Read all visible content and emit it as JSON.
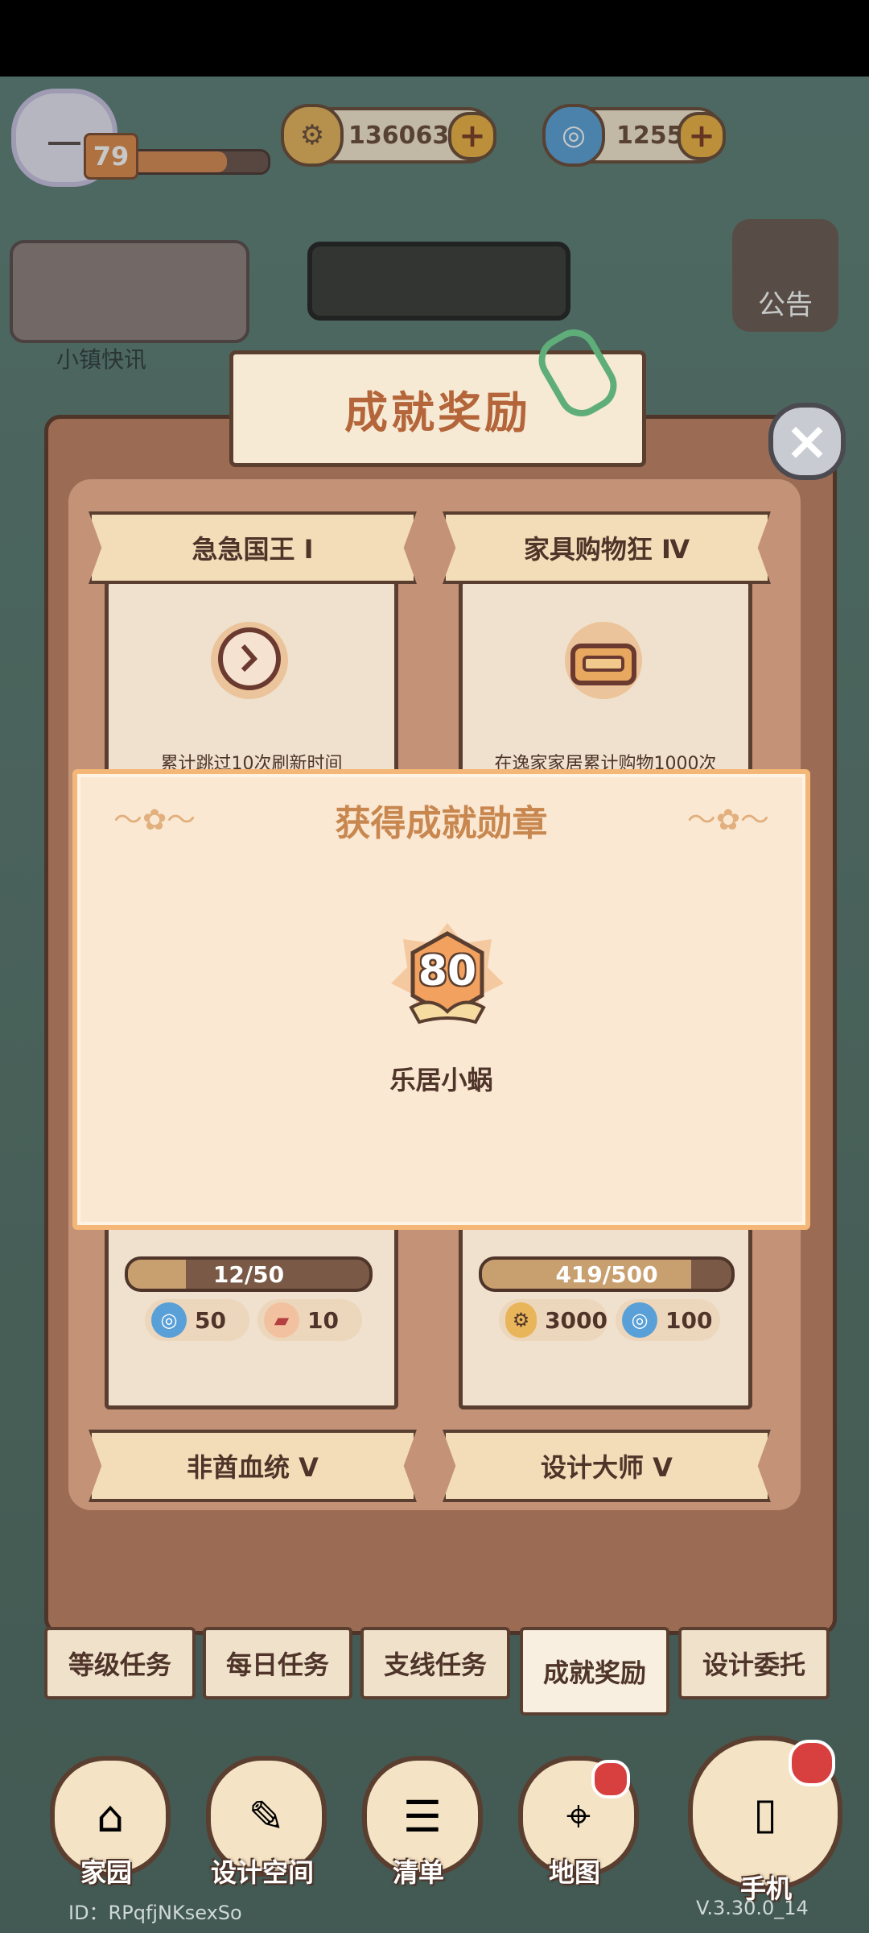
{
  "player": {
    "level": "79",
    "level_progress": 0.7
  },
  "currencies": [
    {
      "name": "coin",
      "icon": "coin-icon",
      "value": "136063"
    },
    {
      "name": "swirl",
      "icon": "swirl-icon",
      "value": "1255"
    }
  ],
  "hud": {
    "news_label": "小镇快讯",
    "notice_label": "公告"
  },
  "panel": {
    "title": "成就奖励"
  },
  "cards": [
    {
      "title": "急急国王 Ⅰ",
      "desc": "累计跳过10次刷新时间"
    },
    {
      "title": "家具购物狂 Ⅳ",
      "desc": "在逸家家居累计购物1000次"
    },
    {
      "title": "",
      "desc": "",
      "progress_text": "12/50",
      "progress": 0.24,
      "rewards": [
        {
          "icon": "swirl-icon",
          "amount": "50"
        },
        {
          "icon": "ticket-icon",
          "amount": "10"
        }
      ]
    },
    {
      "title": "",
      "desc": "",
      "progress_text": "419/500",
      "progress": 0.838,
      "rewards": [
        {
          "icon": "coin-icon",
          "amount": "3000"
        },
        {
          "icon": "swirl-icon",
          "amount": "100"
        }
      ]
    },
    {
      "title": "非酋血统 Ⅴ"
    },
    {
      "title": "设计大师 Ⅴ"
    }
  ],
  "modal": {
    "title": "获得成就勋章",
    "medal_value": "80",
    "medal_name": "乐居小蜗"
  },
  "tabs": [
    "等级任务",
    "每日任务",
    "支线任务",
    "成就奖励",
    "设计委托"
  ],
  "active_tab": "成就奖励",
  "bottom_nav": [
    {
      "label": "家园",
      "icon": "home-icon"
    },
    {
      "label": "设计空间",
      "icon": "design-icon"
    },
    {
      "label": "清单",
      "icon": "list-icon"
    },
    {
      "label": "地图",
      "icon": "map-pin-icon"
    },
    {
      "label": "手机",
      "icon": "phone-icon"
    }
  ],
  "footer": {
    "id_text": "ID：RPqfjNKsexSo",
    "version": "V.3.30.0_14"
  },
  "colors": {
    "panel": "#9c6b53",
    "accent": "#b4653a",
    "modal_bg": "#fbe8d2"
  }
}
